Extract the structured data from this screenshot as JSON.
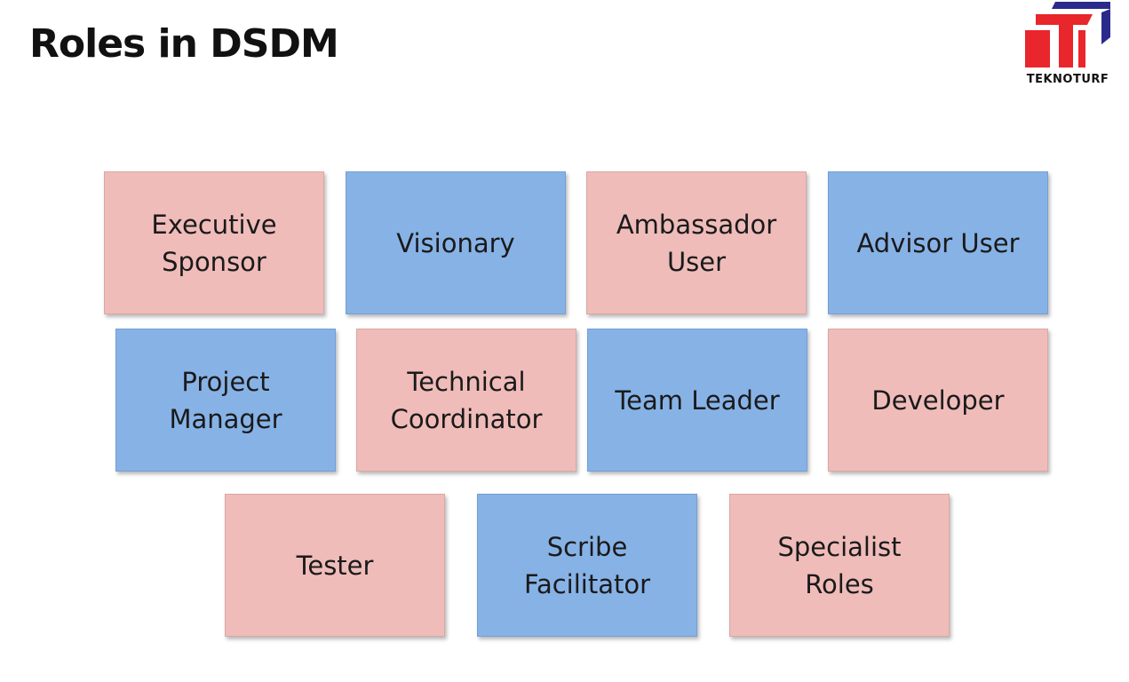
{
  "slide": {
    "title": "Roles in DSDM",
    "logo_text": "TEKNOTURF"
  },
  "colors": {
    "pink": "#efbcba",
    "blue": "#87b2e6",
    "logo_red": "#e8262b",
    "logo_navy": "#2b2a8c"
  },
  "roles": [
    {
      "label": "Executive\nSponsor",
      "color": "pink"
    },
    {
      "label": "Visionary",
      "color": "blue"
    },
    {
      "label": "Ambassador\nUser",
      "color": "pink"
    },
    {
      "label": "Advisor User",
      "color": "blue"
    },
    {
      "label": "Project\nManager",
      "color": "blue"
    },
    {
      "label": "Technical\nCoordinator",
      "color": "pink"
    },
    {
      "label": "Team Leader",
      "color": "blue"
    },
    {
      "label": "Developer",
      "color": "pink"
    },
    {
      "label": "Tester",
      "color": "pink"
    },
    {
      "label": "Scribe\nFacilitator",
      "color": "blue"
    },
    {
      "label": "Specialist\nRoles",
      "color": "pink"
    }
  ]
}
